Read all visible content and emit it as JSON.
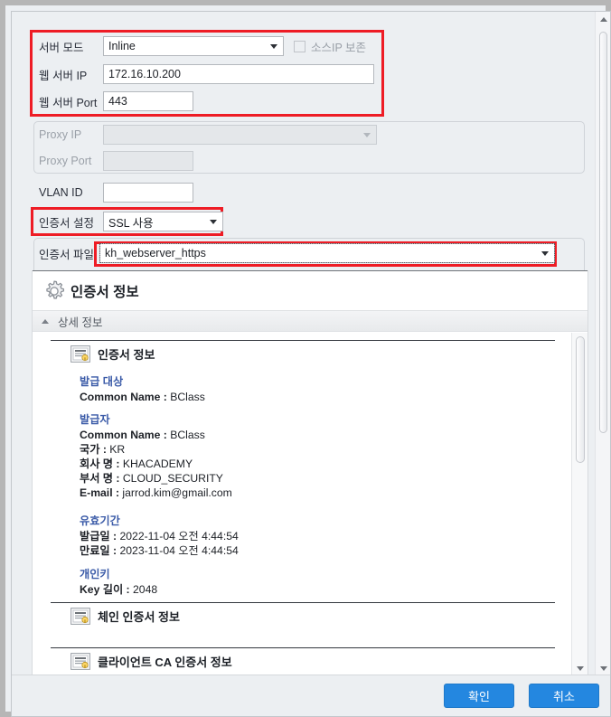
{
  "form": {
    "server_mode": {
      "label": "서버 모드",
      "value": "Inline"
    },
    "preserve_source_ip": {
      "label": "소스IP 보존",
      "checked": false,
      "disabled": true
    },
    "web_server_ip": {
      "label": "웹 서버 IP",
      "value": "172.16.10.200"
    },
    "web_server_port": {
      "label": "웹 서버 Port",
      "value": "443"
    },
    "proxy_ip": {
      "label": "Proxy IP",
      "value": "",
      "disabled": true
    },
    "proxy_port": {
      "label": "Proxy Port",
      "value": "",
      "disabled": true
    },
    "vlan_id": {
      "label": "VLAN ID",
      "value": ""
    },
    "cert_setting": {
      "label": "인증서 설정",
      "value": "SSL 사용"
    },
    "cert_file": {
      "label": "인증서 파일",
      "value": "kh_webserver_https"
    }
  },
  "cert_panel": {
    "title": "인증서 정보",
    "gear_icon": "gear-icon",
    "expander": {
      "label": "상세 정보",
      "expanded": true
    },
    "sections": [
      {
        "icon": "certificate-icon",
        "label": "인증서 정보"
      },
      {
        "icon": "certificate-icon",
        "label": "체인 인증서 정보"
      },
      {
        "icon": "certificate-icon",
        "label": "클라이언트 CA 인증서 정보"
      }
    ],
    "details": {
      "subject": {
        "title": "발급 대상",
        "lines": [
          {
            "key": "Common Name",
            "value": "BClass"
          }
        ]
      },
      "issuer": {
        "title": "발급자",
        "lines": [
          {
            "key": "Common Name",
            "value": "BClass"
          },
          {
            "key": "국가",
            "value": "KR"
          },
          {
            "key": "회사 명",
            "value": "KHACADEMY"
          },
          {
            "key": "부서 명",
            "value": "CLOUD_SECURITY"
          },
          {
            "key": "E-mail",
            "value": "jarrod.kim@gmail.com"
          }
        ]
      },
      "validity": {
        "title": "유효기간",
        "lines": [
          {
            "key": "발급일",
            "value": "2022-11-04 오전 4:44:54"
          },
          {
            "key": "만료일",
            "value": "2023-11-04 오전 4:44:54"
          }
        ]
      },
      "private_key": {
        "title": "개인키",
        "lines": [
          {
            "key": "Key 길이",
            "value": "2048"
          }
        ]
      }
    }
  },
  "footer": {
    "ok": "확인",
    "cancel": "취소"
  },
  "colors": {
    "highlight": "#ee1c25",
    "accent": "#2487e0",
    "group_title": "#3b5ba8",
    "dialog_bg": "#eceff2"
  }
}
